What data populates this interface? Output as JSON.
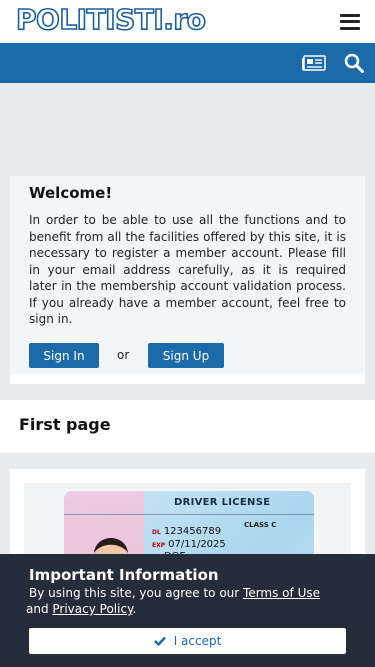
{
  "header": {
    "logo_text": "POLITISTI.ro",
    "brand_color": "#1c5f9c"
  },
  "navbar": {
    "color": "#1c6aa8",
    "icons": [
      "newspaper-icon",
      "search-icon"
    ]
  },
  "welcome": {
    "title": "Welcome!",
    "text": "In order to be able to use all the functions and to benefit from all the facilities offered by this site, it is necessary to register a member account. Please fill in your email address carefully, as it is required later in the membership account validation process. If you already have a member account, feel free to sign in.",
    "signin_label": "Sign In",
    "or_label": "or",
    "signup_label": "Sign Up"
  },
  "first_page": {
    "title": "First page"
  },
  "license_image": {
    "title": "DRIVER LICENSE",
    "dl_label": "DL",
    "dl_value": "123456789",
    "exp_label": "EXP",
    "exp_value": "07/11/2025",
    "ln_label": "LN",
    "ln_value": "DOE",
    "class_label": "CLASS C"
  },
  "cookie": {
    "title": "Important Information",
    "text_prefix": "By using this site, you agree to our ",
    "terms_link": "Terms of Use",
    "text_middle": " and ",
    "privacy_link": "Privacy Policy",
    "text_suffix": ".",
    "accept_label": "I accept"
  }
}
